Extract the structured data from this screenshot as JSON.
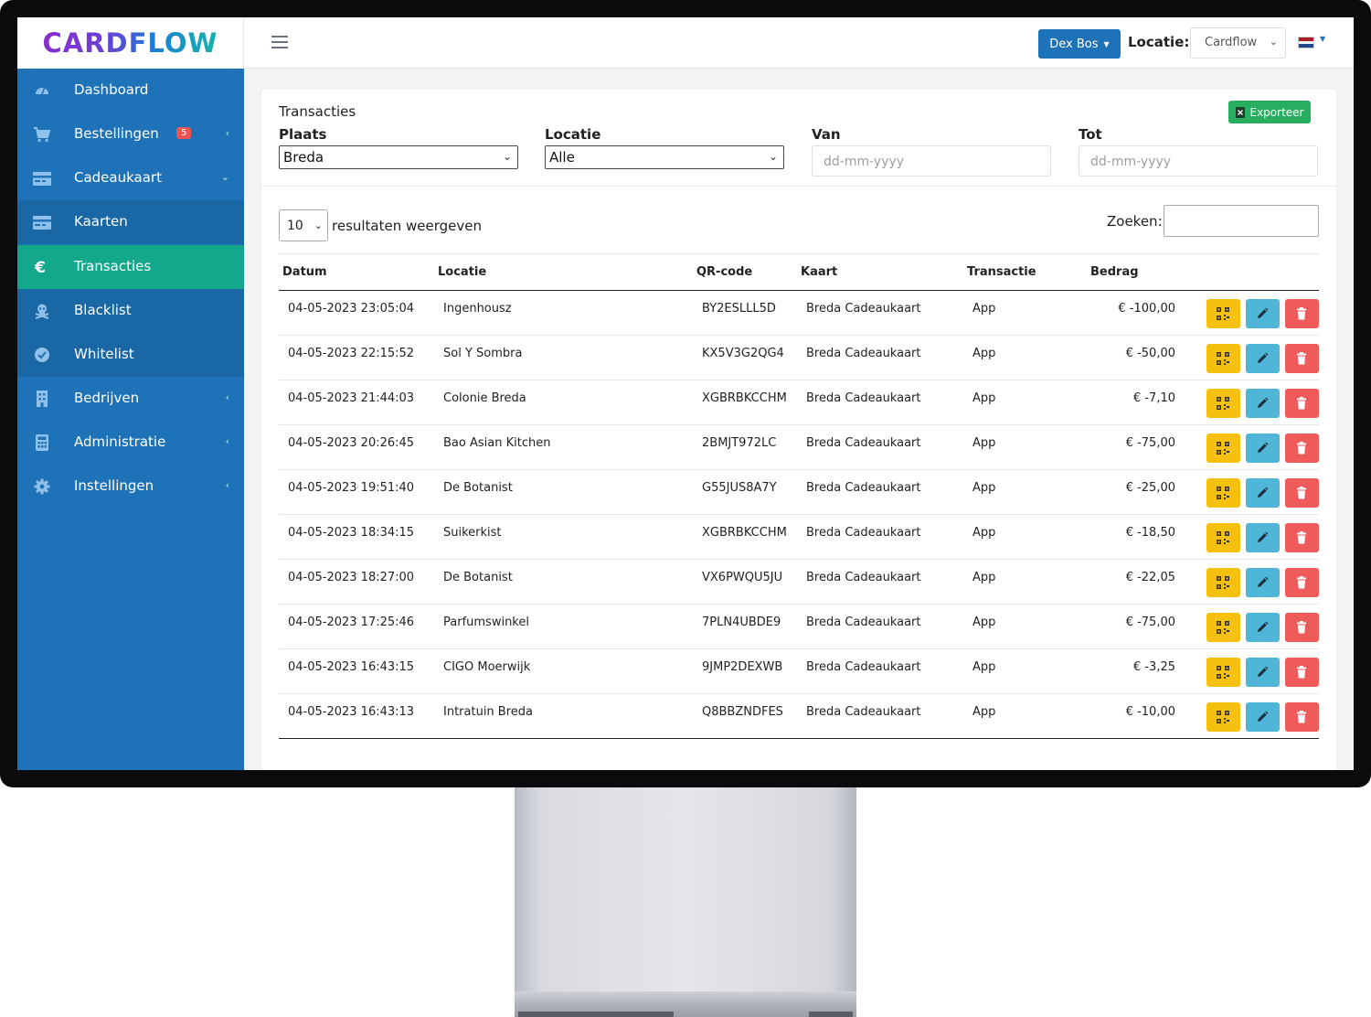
{
  "brand": {
    "name": "CARDFLOW"
  },
  "sidebar": {
    "items": [
      {
        "label": "Dashboard",
        "icon": "gauge-icon"
      },
      {
        "label": "Bestellingen",
        "icon": "cart-icon",
        "badge": "5",
        "chevron": "‹"
      },
      {
        "label": "Cadeaukaart",
        "icon": "card-icon",
        "chevron": "⌄"
      },
      {
        "label": "Kaarten",
        "icon": "card-icon"
      },
      {
        "label": "Transacties",
        "icon": "euro-icon",
        "active": true
      },
      {
        "label": "Blacklist",
        "icon": "skull-icon"
      },
      {
        "label": "Whitelist",
        "icon": "check-badge-icon"
      },
      {
        "label": "Bedrijven",
        "icon": "building-icon",
        "chevron": "‹"
      },
      {
        "label": "Administratie",
        "icon": "calculator-icon",
        "chevron": "‹"
      },
      {
        "label": "Instellingen",
        "icon": "gear-icon",
        "chevron": "‹"
      }
    ]
  },
  "topbar": {
    "user": "Dex Bos",
    "location_label": "Locatie:",
    "location_value": "Cardflow",
    "language_flag": "nl-flag-icon"
  },
  "card": {
    "title": "Transacties",
    "export_label": "Exporteer",
    "filters": {
      "plaats_label": "Plaats",
      "plaats_value": "Breda",
      "locatie_label": "Locatie",
      "locatie_value": "Alle",
      "van_label": "Van",
      "van_placeholder": "dd-mm-yyyy",
      "tot_label": "Tot",
      "tot_placeholder": "dd-mm-yyyy"
    },
    "length_value": "10",
    "length_label": "resultaten weergeven",
    "search_label": "Zoeken:"
  },
  "table": {
    "headers": [
      "Datum",
      "Locatie",
      "QR-code",
      "Kaart",
      "Transactie",
      "Bedrag"
    ],
    "rows": [
      [
        "04-05-2023 23:05:04",
        "Ingenhousz",
        "BY2ESLLL5D",
        "Breda Cadeaukaart",
        "App",
        "€ -100,00"
      ],
      [
        "04-05-2023 22:15:52",
        "Sol Y Sombra",
        "KX5V3G2QG4",
        "Breda Cadeaukaart",
        "App",
        "€ -50,00"
      ],
      [
        "04-05-2023 21:44:03",
        "Colonie Breda",
        "XGBRBKCCHM",
        "Breda Cadeaukaart",
        "App",
        "€ -7,10"
      ],
      [
        "04-05-2023 20:26:45",
        "Bao Asian Kitchen",
        "2BMJT972LC",
        "Breda Cadeaukaart",
        "App",
        "€ -75,00"
      ],
      [
        "04-05-2023 19:51:40",
        "De Botanist",
        "G55JUS8A7Y",
        "Breda Cadeaukaart",
        "App",
        "€ -25,00"
      ],
      [
        "04-05-2023 18:34:15",
        "Suikerkist",
        "XGBRBKCCHM",
        "Breda Cadeaukaart",
        "App",
        "€ -18,50"
      ],
      [
        "04-05-2023 18:27:00",
        "De Botanist",
        "VX6PWQU5JU",
        "Breda Cadeaukaart",
        "App",
        "€ -22,05"
      ],
      [
        "04-05-2023 17:25:46",
        "Parfumswinkel",
        "7PLN4UBDE9",
        "Breda Cadeaukaart",
        "App",
        "€ -75,00"
      ],
      [
        "04-05-2023 16:43:15",
        "CIGO Moerwijk",
        "9JMP2DEXWB",
        "Breda Cadeaukaart",
        "App",
        "€ -3,25"
      ],
      [
        "04-05-2023 16:43:13",
        "Intratuin Breda",
        "Q8BBZNDFES",
        "Breda Cadeaukaart",
        "App",
        "€ -10,00"
      ]
    ]
  },
  "colors": {
    "sidebar": "#1d72b8",
    "sidebar_active": "#13a88c",
    "primary": "#1d72b8",
    "success": "#27ae60",
    "warning": "#f6c00f",
    "info": "#4fb6d8",
    "danger": "#ef5a5a"
  }
}
